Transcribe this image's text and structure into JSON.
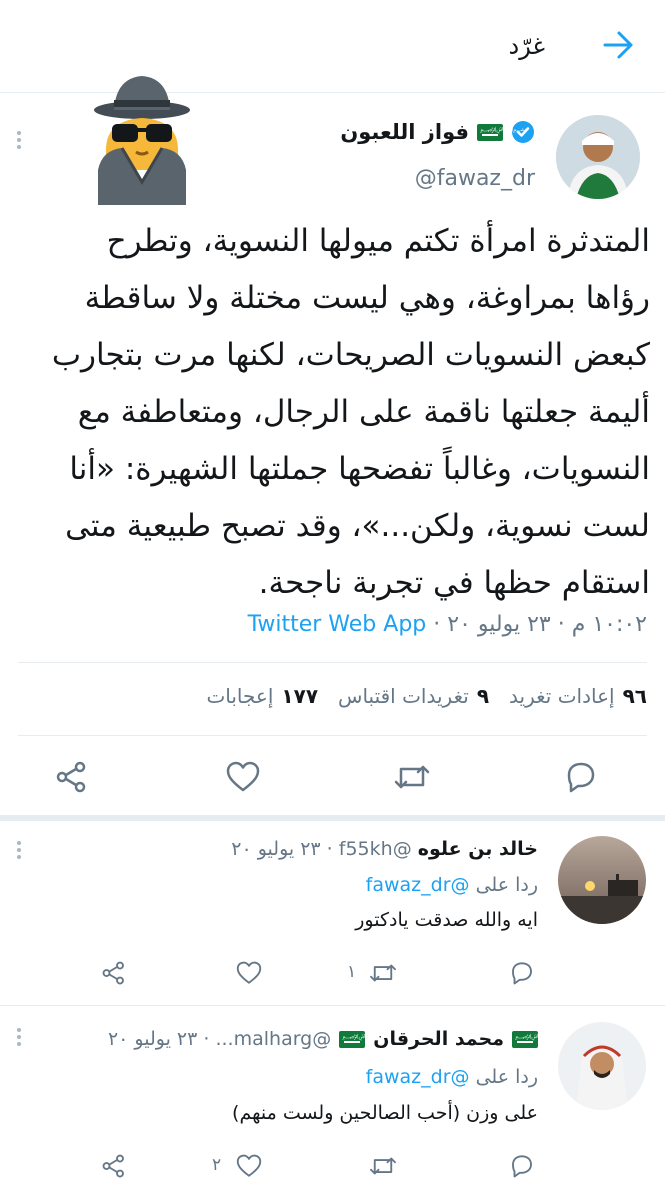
{
  "header": {
    "title": "غرّد"
  },
  "tweet": {
    "name": "فواز اللعبون",
    "handle": "@fawaz_dr",
    "lines": [
      "المتدثرة امرأة تكتم ميولها النسوية، وتطرح",
      "رؤاها بمراوغة، وهي ليست مختلة ولا ساقطة",
      "كبعض النسويات الصريحات، لكنها مرت بتجارب",
      "أليمة جعلتها ناقمة على الرجال، ومتعاطفة مع",
      "النسويات، وغالباً تفضحها جملتها الشهيرة: «أنا",
      "لست نسوية، ولكن...»، وقد تصبح طبيعية متى",
      "استقام حظها في تجربة ناجحة."
    ],
    "meta_time": "١٠:٠٢ م · ٢٣ يوليو ٢٠ ·",
    "app": "Twitter Web App",
    "retweets_count": "٩٦",
    "retweets_label": "إعادات تغريد",
    "quotes_count": "٩",
    "quotes_label": "تغريدات اقتباس",
    "likes_count": "١٧٧",
    "likes_label": "إعجابات"
  },
  "replies": [
    {
      "name": "خالد بن علوه",
      "handle_date": "@f55kh · ٢٣ يوليو ٢٠",
      "replying_prefix": "ردا على",
      "replying_handle": "@fawaz_dr",
      "text": "ايه والله صدقت يادكتور",
      "retweets": "١",
      "likes": ""
    },
    {
      "name": "محمد الحرقان",
      "handle_date": "@malharg... · ٢٣ يوليو ٢٠",
      "replying_prefix": "ردا على",
      "replying_handle": "@fawaz_dr",
      "text": "على وزن (أحب الصالحين ولست منهم)",
      "retweets": "",
      "likes": "٢"
    }
  ],
  "colors": {
    "accent": "#1da1f2",
    "muted": "#657786",
    "border": "#e6ecf0",
    "flag": "#0f7a3a"
  },
  "icons": [
    "back-arrow-icon",
    "spy-emoji-icon",
    "verified-icon",
    "saudi-flag-icon",
    "more-dots-icon",
    "share-icon",
    "like-icon",
    "retweet-icon",
    "reply-icon"
  ]
}
